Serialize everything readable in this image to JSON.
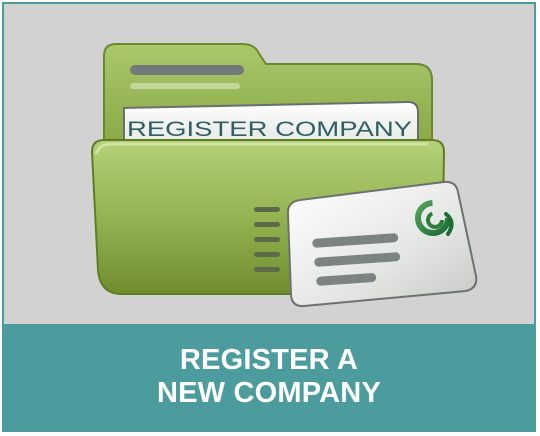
{
  "tile": {
    "label_line1": "REGISTER A",
    "label_line2": "NEW COMPANY"
  },
  "icon": {
    "name": "folder-document-icon",
    "paper_text": "REGISTER COMPANY"
  },
  "colors": {
    "panel_background": "#d2d2d2",
    "label_background": "#4d9c9d",
    "folder_green": "#8fb04a",
    "label_text": "#ffffff"
  }
}
